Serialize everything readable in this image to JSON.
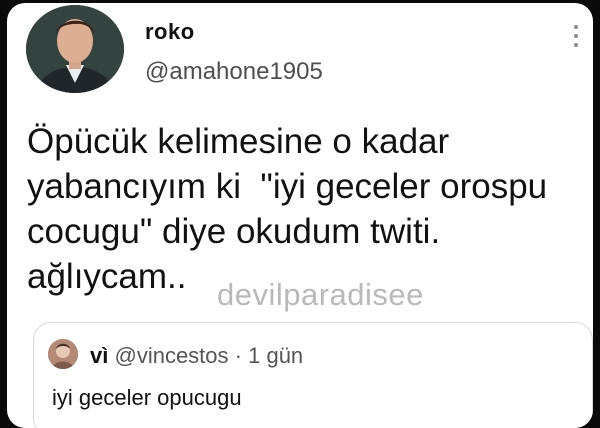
{
  "tweet": {
    "display_name": "roko",
    "handle": "@amahone1905",
    "text_lines": [
      "Öpücük kelimesine o kadar",
      "yabancıyım ki  \"iyi geceler orospu",
      "cocugu\" diye okudum twiti.",
      "ağlıycam.."
    ],
    "watermark": "devilparadisee"
  },
  "quoted": {
    "display_name": "vì",
    "handle": "@vincestos",
    "separator": "·",
    "time": "1 gün",
    "text": "iyi geceler opucugu"
  },
  "icons": {
    "avatar": "profile-photo",
    "more": "vertical-dots-icon",
    "quoted_avatar": "profile-photo-small"
  }
}
